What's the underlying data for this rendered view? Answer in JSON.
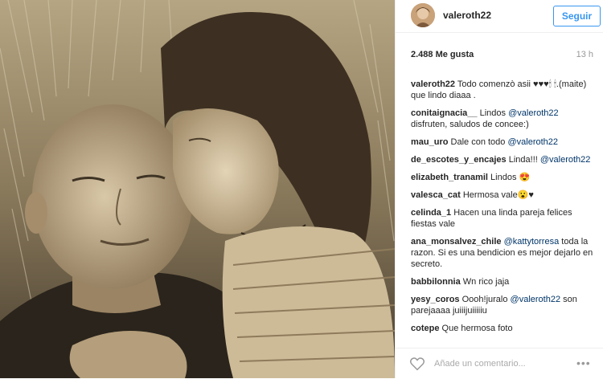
{
  "post": {
    "username": "valeroth22",
    "follow_label": "Seguir",
    "likes": "2.488 Me gusta",
    "time_ago": "13 h"
  },
  "comments": [
    {
      "user": "valeroth22",
      "parts": [
        {
          "type": "text",
          "text": "Todo comenzò asii ♥♥♥🕯 🕯.(maite) que lindo diaaa ."
        }
      ]
    },
    {
      "user": "conitaignacia__",
      "parts": [
        {
          "type": "text",
          "text": "Lindos "
        },
        {
          "type": "mention",
          "text": "@valeroth22"
        },
        {
          "type": "text",
          "text": " disfruten, saludos de concee:)"
        }
      ]
    },
    {
      "user": "mau_uro",
      "parts": [
        {
          "type": "text",
          "text": "Dale con todo "
        },
        {
          "type": "mention",
          "text": "@valeroth22"
        }
      ]
    },
    {
      "user": "de_escotes_y_encajes",
      "parts": [
        {
          "type": "text",
          "text": "Linda!!! "
        },
        {
          "type": "mention",
          "text": "@valeroth22"
        }
      ]
    },
    {
      "user": "elizabeth_tranamil",
      "parts": [
        {
          "type": "text",
          "text": "Lindos 😍"
        }
      ]
    },
    {
      "user": "valesca_cat",
      "parts": [
        {
          "type": "text",
          "text": "Hermosa vale😮♥"
        }
      ]
    },
    {
      "user": "celinda_1",
      "parts": [
        {
          "type": "text",
          "text": "Hacen una linda pareja felices fiestas vale"
        }
      ]
    },
    {
      "user": "ana_monsalvez_chile",
      "parts": [
        {
          "type": "mention",
          "text": "@kattytorresa"
        },
        {
          "type": "text",
          "text": " toda la razon. Si es una bendicion es mejor dejarlo en secreto."
        }
      ]
    },
    {
      "user": "babbilonnia",
      "parts": [
        {
          "type": "text",
          "text": "Wn rico jaja"
        }
      ]
    },
    {
      "user": "yesy_coros",
      "parts": [
        {
          "type": "text",
          "text": "Oooh!juralo "
        },
        {
          "type": "mention",
          "text": "@valeroth22"
        },
        {
          "type": "text",
          "text": " son parejaaaa juiiijuiiiiiu"
        }
      ]
    },
    {
      "user": "cotepe",
      "parts": [
        {
          "type": "text",
          "text": "Que hermosa foto"
        }
      ]
    }
  ],
  "footer": {
    "comment_placeholder": "Añade un comentario...",
    "more_label": "•••"
  },
  "icons": {
    "like": "heart-outline-icon",
    "more": "more-options-icon"
  },
  "colors": {
    "accent": "#3897f0",
    "mention": "#003569",
    "border": "#efefef",
    "muted": "#999999",
    "photo_tone": "#8c7a5f"
  }
}
